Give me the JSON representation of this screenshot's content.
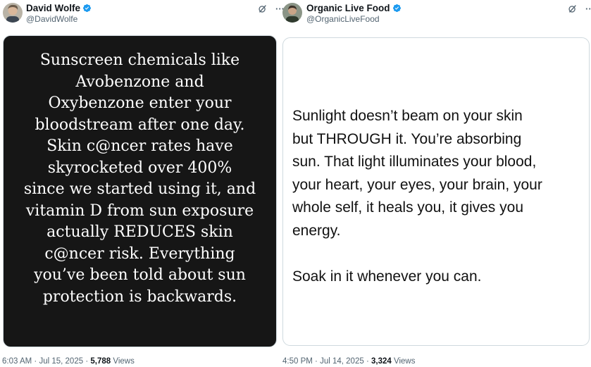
{
  "tweets": [
    {
      "author": {
        "name": "David Wolfe",
        "handle": "@DavidWolfe",
        "verified": true
      },
      "media": {
        "style": "dark-serif",
        "lines": [
          "Sunscreen chemicals like",
          "Avobenzone and",
          "Oxybenzone enter your",
          "bloodstream after one day.",
          "Skin c@ncer rates have",
          "skyrocketed over 400%",
          "since we started using it, and",
          "vitamin D from sun exposure",
          "actually REDUCES skin",
          "c@ncer risk. Everything",
          "you’ve been told about sun",
          "protection is backwards."
        ]
      },
      "meta": {
        "time": "6:03 AM",
        "sep1": "·",
        "date": "Jul 15, 2025",
        "sep2": "·",
        "views_count": "5,788",
        "views_label": "Views"
      }
    },
    {
      "author": {
        "name": "Organic Live Food",
        "handle": "@OrganicLiveFood",
        "verified": true
      },
      "media": {
        "style": "light-sans",
        "paragraph1": [
          "Sunlight doesn’t beam on your skin",
          "but THROUGH it. You’re absorbing",
          "sun. That light illuminates your blood,",
          "your heart, your eyes, your brain, your",
          "whole self, it heals you, it gives you",
          "energy."
        ],
        "paragraph2": "Soak in it whenever you can."
      },
      "meta": {
        "time": "4:50 PM",
        "sep1": "·",
        "date": "Jul 14, 2025",
        "sep2": "·",
        "views_count": "3,324",
        "views_label": "Views"
      }
    }
  ],
  "icons": {
    "verified": "verified-badge-icon",
    "grok": "grok-icon",
    "more": "more-options-icon"
  },
  "colors": {
    "verified_blue": "#1d9bf0",
    "muted_text": "#536471",
    "dark_card": "#161616"
  },
  "ui": {
    "more_glyph": "···"
  }
}
